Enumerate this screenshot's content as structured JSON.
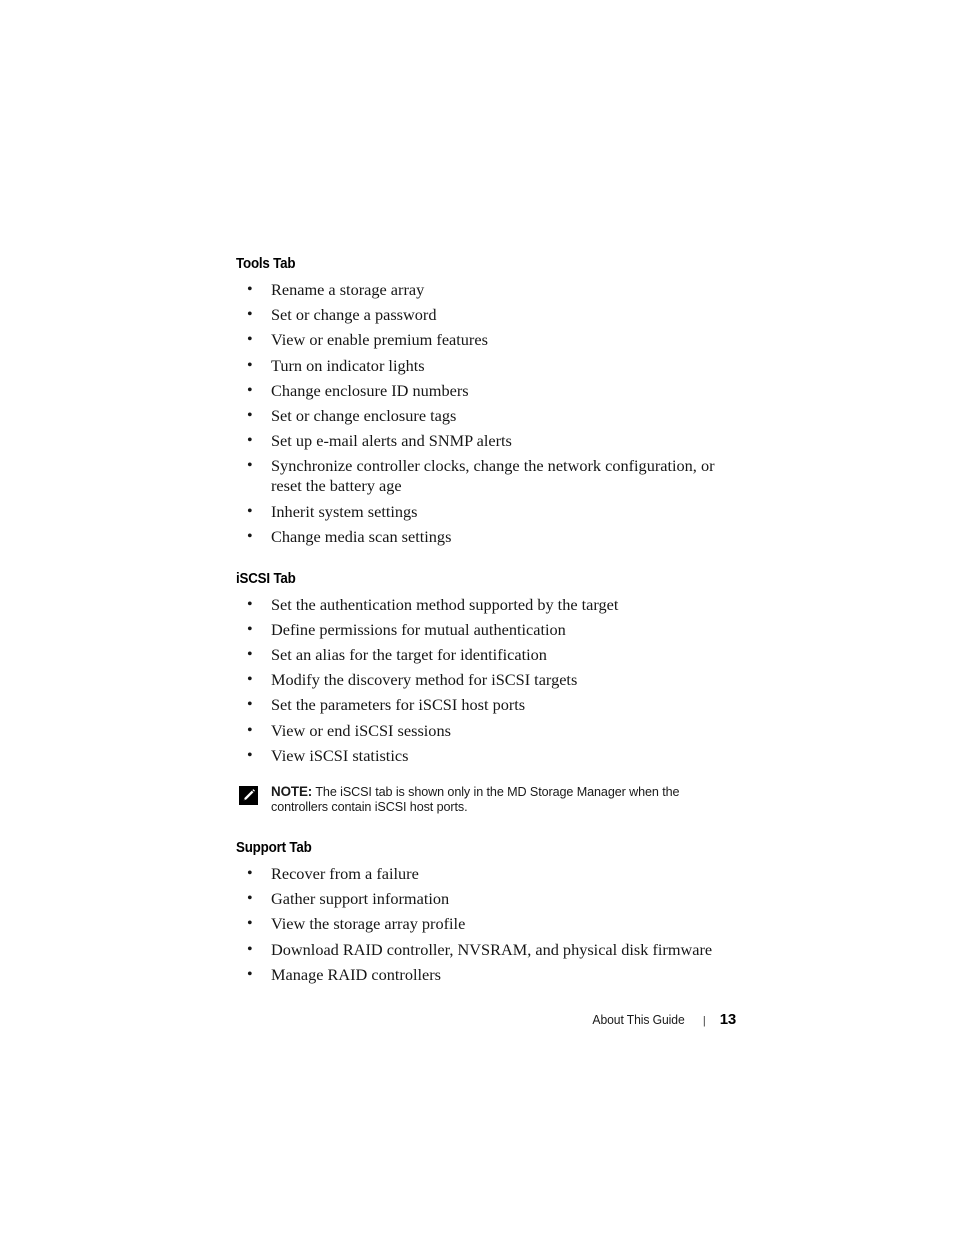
{
  "document": {
    "background_color": "#ffffff",
    "text_color": "#161616"
  },
  "sections": [
    {
      "heading": "Tools Tab",
      "bullets": [
        "Rename a storage array",
        "Set or change a password",
        "View or enable premium features",
        "Turn on indicator lights",
        "Change enclosure ID numbers",
        "Set or change enclosure tags",
        "Set up e-mail alerts and SNMP alerts",
        "Synchronize controller clocks, change the network configuration, or reset the battery age",
        "Inherit system settings",
        "Change media scan settings"
      ]
    },
    {
      "heading": "iSCSI Tab",
      "bullets": [
        "Set the authentication method supported by the target",
        "Define permissions for mutual authentication",
        "Set an alias for the target for identification",
        "Modify the discovery method for iSCSI targets",
        "Set the parameters for iSCSI host ports",
        "View or end iSCSI sessions",
        "View iSCSI statistics"
      ]
    },
    {
      "heading": "Support Tab",
      "bullets": [
        "Recover from a failure",
        "Gather support information",
        "View the storage array profile",
        "Download RAID controller, NVSRAM, and physical disk firmware",
        "Manage RAID controllers"
      ]
    }
  ],
  "note": {
    "icon": "pencil-icon",
    "label": "NOTE:",
    "text": "The iSCSI tab is shown only in the MD Storage Manager when the controllers contain iSCSI host ports."
  },
  "footer": {
    "label": "About This Guide",
    "separator": "|",
    "page_number": "13"
  },
  "bullet_glyph": "•"
}
